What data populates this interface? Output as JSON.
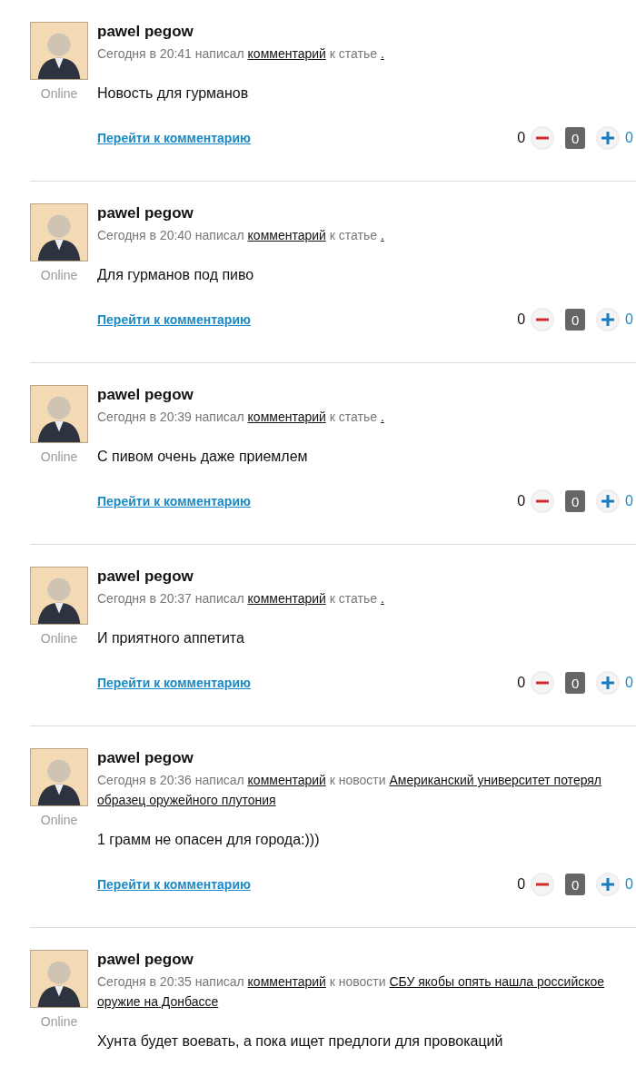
{
  "comments": [
    {
      "author": "pawel pegow",
      "status": "Online",
      "meta_prefix": "Сегодня в 20:41 написал",
      "comment_link": "комментарий",
      "meta_middle": "к статье",
      "target_link": ".",
      "text": "Новость для гурманов",
      "goto_link": "Перейти к комментарию",
      "votes": {
        "score": "0",
        "rating": "0",
        "plus": "0"
      }
    },
    {
      "author": "pawel pegow",
      "status": "Online",
      "meta_prefix": "Сегодня в 20:40 написал",
      "comment_link": "комментарий",
      "meta_middle": "к статье",
      "target_link": ".",
      "text": "Для гурманов под пиво",
      "goto_link": "Перейти к комментарию",
      "votes": {
        "score": "0",
        "rating": "0",
        "plus": "0"
      }
    },
    {
      "author": "pawel pegow",
      "status": "Online",
      "meta_prefix": "Сегодня в 20:39 написал",
      "comment_link": "комментарий",
      "meta_middle": "к статье",
      "target_link": ".",
      "text": "С пивом очень даже приемлем",
      "goto_link": "Перейти к комментарию",
      "votes": {
        "score": "0",
        "rating": "0",
        "plus": "0"
      }
    },
    {
      "author": "pawel pegow",
      "status": "Online",
      "meta_prefix": "Сегодня в 20:37 написал",
      "comment_link": "комментарий",
      "meta_middle": "к статье",
      "target_link": ".",
      "text": "И приятного аппетита",
      "goto_link": "Перейти к комментарию",
      "votes": {
        "score": "0",
        "rating": "0",
        "plus": "0"
      }
    },
    {
      "author": "pawel pegow",
      "status": "Online",
      "meta_prefix": "Сегодня в 20:36 написал",
      "comment_link": "комментарий",
      "meta_middle": "к новости",
      "target_link": [
        "Американский университет потерял",
        "образец оружейного плутония"
      ],
      "text": "1 грамм не опасен для города:)))",
      "goto_link": "Перейти к комментарию",
      "votes": {
        "score": "0",
        "rating": "0",
        "plus": "0"
      }
    },
    {
      "author": "pawel pegow",
      "status": "Online",
      "meta_prefix": "Сегодня в 20:35 написал",
      "comment_link": "комментарий",
      "meta_middle": "к новости",
      "target_link": [
        "СБУ якобы опять нашла российское",
        "оружие на Донбассе"
      ],
      "text": "Хунта будет воевать, а пока ищет предлоги для провокаций"
    }
  ]
}
